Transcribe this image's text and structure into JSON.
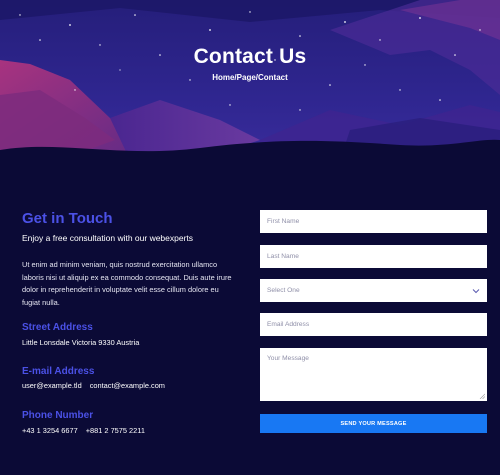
{
  "hero": {
    "title": "Contact Us",
    "breadcrumb": "Home/Page/Contact"
  },
  "info": {
    "heading": "Get in Touch",
    "subheading": "Enjoy a free consultation with our webexperts",
    "body": "Ut enim ad minim veniam, quis nostrud exercitation ullamco laboris nisi ut aliquip ex ea commodo consequat. Duis aute irure dolor in reprehenderit in voluptate velit esse cillum dolore eu fugiat nulla.",
    "address_title": "Street Address",
    "address_text": "Little Lonsdale Victoria 9330 Austria",
    "email_title": "E-mail Address",
    "emails": [
      "user@example.tld",
      "contact@example.com"
    ],
    "phone_title": "Phone Number",
    "phones": [
      "+43 1 3254 6677",
      "+881 2 7575 2211"
    ]
  },
  "form": {
    "first_name_placeholder": "First Name",
    "last_name_placeholder": "Last Name",
    "select_value": "Select One",
    "email_placeholder": "Email Address",
    "message_placeholder": "Your Message",
    "submit_label": "SEND YOUR MESSAGE"
  },
  "colors": {
    "page_background": "#0b0a36",
    "accent_heading": "#4b51e6",
    "button": "#1878f3",
    "hero_sky": "#2b2385",
    "hero_mountains": "#8a2e7a"
  },
  "icons": {
    "select_chevron": "chevron-down-icon",
    "textarea_grip": "resize-grip-icon"
  }
}
